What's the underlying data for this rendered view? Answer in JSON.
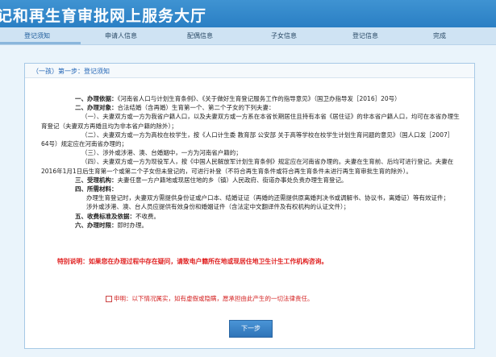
{
  "header": {
    "title": "记和再生育审批网上服务大厅"
  },
  "steps": [
    {
      "label": "登记须知"
    },
    {
      "label": "申请人信息"
    },
    {
      "label": "配偶信息"
    },
    {
      "label": "子女信息"
    },
    {
      "label": "登记信息"
    },
    {
      "label": "完成"
    }
  ],
  "panel": {
    "title": "（一孩）第一步：登记须知"
  },
  "content": {
    "p1_label": "一、办理依据：",
    "p1_text": "《河南省人口与计划生育条例》、《关于做好生育登记服务工作的指导意见》（国卫办指导发［2016］20号）",
    "p2_label": "二、办理对象：",
    "p2_text": "合法结婚（含再婚）生育第一个、第二个子女的下列夫妻：",
    "p2_a": "（一）、夫妻双方或一方为我省户籍人口，以及夫妻双方或一方系在本省长期居住且持有本省《居住证》的非本省户籍人口，均可在本省办理生育登记（夫妻双方再婚且均为非本省户籍的除外）；",
    "p2_b": "（二）、夫妻双方或一方为高校在校学生，按《人口计生委 教育部 公安部 关于高等学校在校学生计划生育问题的意见》（国人口发［2007］64号）规定应在河南省办理的；",
    "p2_c": "（三）、涉外或涉港、澳、台婚姻中，一方为河南省户籍的；",
    "p2_d": "（四）、夫妻双方或一方为现役军人，按《中国人民解放军计划生育条例》规定应在河南省办理的。夫妻在生育前、后均可进行登记。夫妻在2016年1月1日后生育第一个或第二个子女但未登记的，可进行补登（不符合再生育条件或符合再生育条件未进行再生育审批生育的除外）。",
    "p3_label": "三、受理机构：",
    "p3_text": "夫妻任意一方户籍地或现居住地的乡（镇）人民政府、街道办事处负责办理生育登记。",
    "p4_label": "四、所需材料：",
    "p4_a": "办理生育登记时，夫妻双方需提供身份证或户口本、结婚证证（再婚的还需提供原离婚判决书或调解书、协议书，离婚证）等有效证件；",
    "p4_b": "涉外或涉港、澳、台人员应提供有效身份和婚姻证件（含法定中文翻译件及有权机构的认证文件）；",
    "p5_label": "五、收费标准及依据：",
    "p5_text": "不收费。",
    "p6_label": "六、办理时限：",
    "p6_text": "即时办理。"
  },
  "notice": "特别说明：如果您在办理过程中存在疑问，请致电户籍所在地或现居住地卫生计生工作机构咨询。",
  "declaration": "申明：以下情况属实，如有虚假或隐瞒，愿承担由此产生的一切法律责任。",
  "next_button": "下一步"
}
